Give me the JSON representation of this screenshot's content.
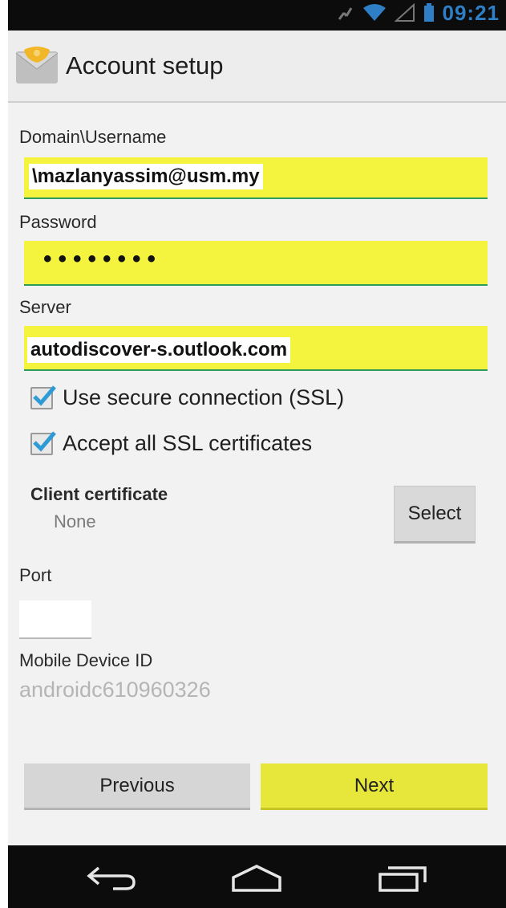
{
  "status_bar": {
    "time": "09:21",
    "icons": [
      "missed-call-icon",
      "wifi-icon",
      "signal-icon",
      "battery-icon"
    ]
  },
  "action_bar": {
    "title": "Account setup",
    "icon": "email-envelope-icon"
  },
  "form": {
    "username_label": "Domain\\Username",
    "username_value": "\\mazlanyassim@usm.my",
    "password_label": "Password",
    "password_value": "••••••••",
    "server_label": "Server",
    "server_value": "autodiscover-s.outlook.com",
    "ssl_label": "Use secure connection (SSL)",
    "ssl_checked": true,
    "accept_ssl_label": "Accept all SSL certificates",
    "accept_ssl_checked": true,
    "client_cert_title": "Client certificate",
    "client_cert_value": "None",
    "select_label": "Select",
    "port_label": "Port",
    "port_value": "",
    "device_id_label": "Mobile Device ID",
    "device_id_value": "androidc610960326"
  },
  "buttons": {
    "previous": "Previous",
    "next": "Next"
  },
  "nav_bar": {
    "icons": [
      "back-icon",
      "home-icon",
      "recent-apps-icon"
    ]
  },
  "colors": {
    "highlight": "#f4f43e",
    "field_underline": "#2e9b5a",
    "checkbox_check": "#2f9bd6",
    "status_time": "#2f7fc6"
  }
}
